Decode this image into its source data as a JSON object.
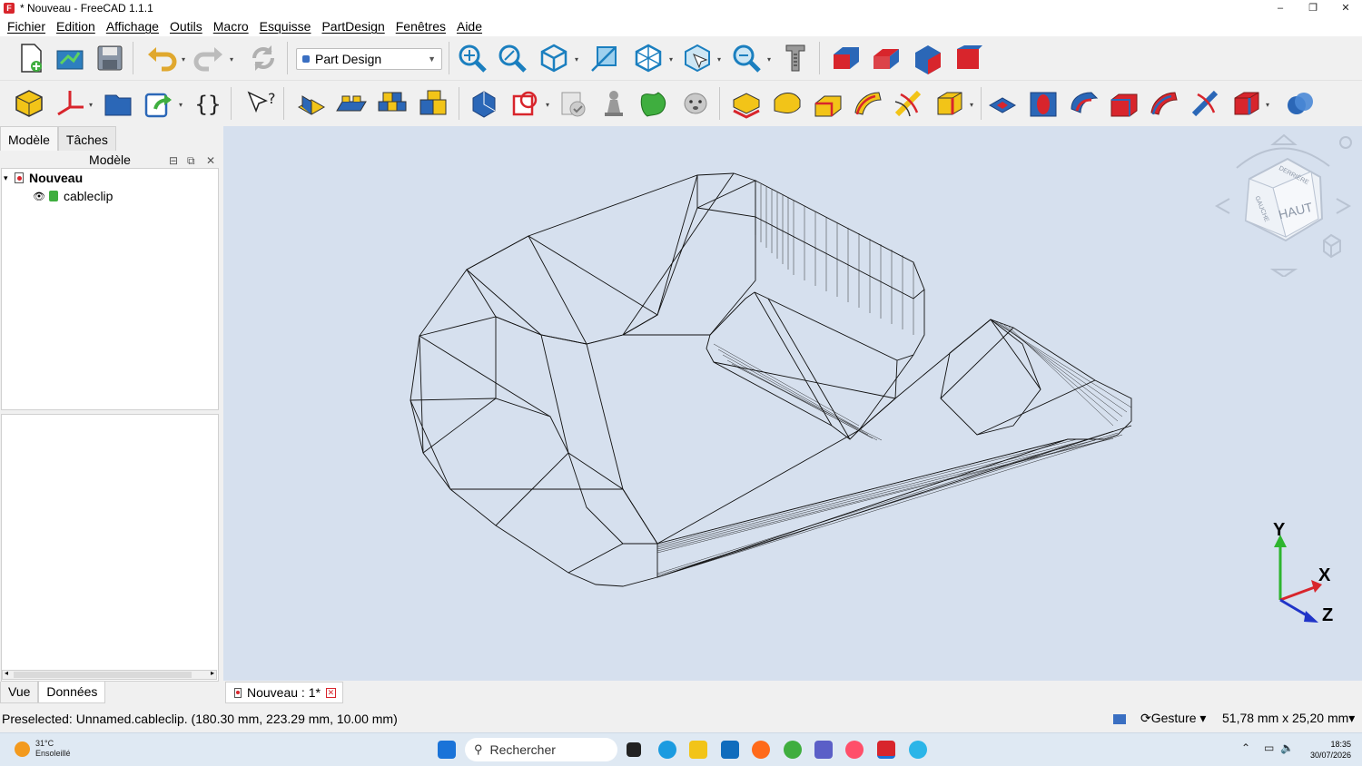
{
  "window": {
    "title": "* Nouveau - FreeCAD 1.1.1",
    "minimize": "–",
    "maximize": "❐",
    "close": "✕"
  },
  "menu": [
    "Fichier",
    "Edition",
    "Affichage",
    "Outils",
    "Macro",
    "Esquisse",
    "PartDesign",
    "Fenêtres",
    "Aide"
  ],
  "workbench": {
    "selected": "Part Design"
  },
  "left_panel": {
    "tabs": [
      "Modèle",
      "Tâches"
    ],
    "tree_header": "Modèle",
    "tree": [
      {
        "label": "Nouveau",
        "children": [
          {
            "label": "cableclip"
          }
        ]
      }
    ],
    "bottom_tabs": [
      "Vue",
      "Données"
    ]
  },
  "document_tab": {
    "label": "Nouveau : 1*"
  },
  "navcube": {
    "face_top": "HAUT",
    "face_front": "DERRIÈRE",
    "face_left": "GAUCHE"
  },
  "axes": {
    "x": "X",
    "y": "Y",
    "z": "Z"
  },
  "status": {
    "message": "Preselected: Unnamed.cableclip. (180.30 mm, 223.29 mm, 10.00 mm)",
    "navigation": "Gesture",
    "dimensions": "51,78 mm x 25,20 mm"
  },
  "taskbar": {
    "temperature": "31°C",
    "weather": "Ensoleillé",
    "search_placeholder": "Rechercher",
    "time": "18:35",
    "date": "30/07/2026"
  },
  "colors": {
    "accent": "#3a6fc2",
    "red_feature": "#d8252c",
    "viewport": "#d6e0ee"
  }
}
